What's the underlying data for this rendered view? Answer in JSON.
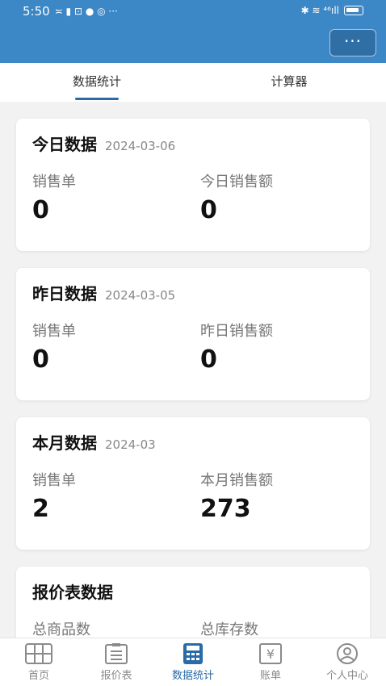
{
  "status_bar": {
    "time": "5:50",
    "left_glyphs": "≍ ▮ ⊡ ● ◎ ···",
    "right_glyphs": "✱ ≋ ⁴⁶ıll"
  },
  "app_bar": {
    "more_label": "···"
  },
  "tabs": [
    {
      "label": "数据统计",
      "active": true
    },
    {
      "label": "计算器",
      "active": false
    }
  ],
  "cards": {
    "today": {
      "title": "今日数据",
      "date": "2024-03-06",
      "left_label": "销售单",
      "left_value": "0",
      "right_label": "今日销售额",
      "right_value": "0"
    },
    "yesterday": {
      "title": "昨日数据",
      "date": "2024-03-05",
      "left_label": "销售单",
      "left_value": "0",
      "right_label": "昨日销售额",
      "right_value": "0"
    },
    "month": {
      "title": "本月数据",
      "date": "2024-03",
      "left_label": "销售单",
      "left_value": "2",
      "right_label": "本月销售额",
      "right_value": "273"
    },
    "pricelist": {
      "title": "报价表数据",
      "left_label": "总商品数",
      "right_label": "总库存数"
    }
  },
  "bottom_nav": [
    {
      "label": "首页",
      "icon": "grid-icon"
    },
    {
      "label": "报价表",
      "icon": "clipboard-list-icon"
    },
    {
      "label": "数据统计",
      "icon": "calculator-icon",
      "active": true
    },
    {
      "label": "账单",
      "icon": "yen-bill-icon"
    },
    {
      "label": "个人中心",
      "icon": "user-icon"
    }
  ],
  "colors": {
    "primary": "#3c87c6",
    "active": "#2a6aa6",
    "inactive": "#8a8a8a"
  }
}
